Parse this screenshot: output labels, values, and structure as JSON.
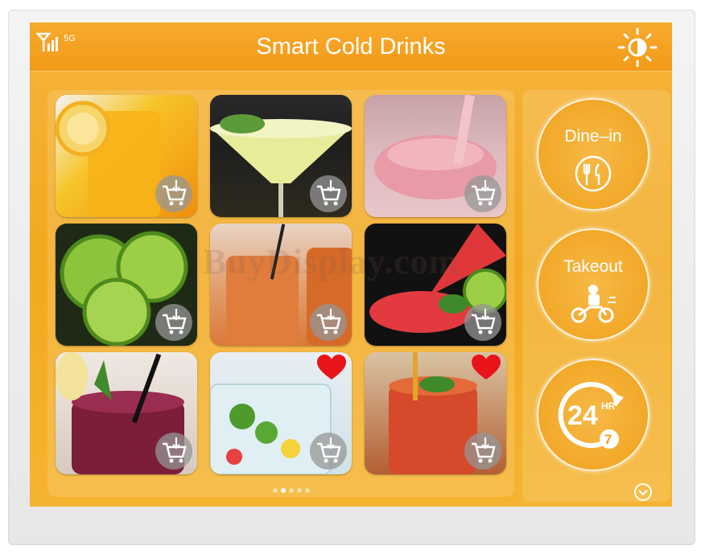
{
  "header": {
    "title": "Smart Cold Drinks",
    "network_label": "5G"
  },
  "drinks": [
    {
      "name": "orange juice",
      "favorite": false
    },
    {
      "name": "lime martini",
      "favorite": false
    },
    {
      "name": "strawberry smoothie",
      "favorite": false
    },
    {
      "name": "limes",
      "favorite": false
    },
    {
      "name": "papaya juice",
      "favorite": false
    },
    {
      "name": "watermelon cocktail",
      "favorite": false
    },
    {
      "name": "berry smoothie",
      "favorite": false
    },
    {
      "name": "mojito",
      "favorite": true
    },
    {
      "name": "red fizz",
      "favorite": true
    }
  ],
  "pager": {
    "pages": 5,
    "active": 2
  },
  "side": {
    "dine_in_label": "Dine–in",
    "takeout_label": "Takeout",
    "hours_label": "24",
    "hr_label": "HR",
    "days_label": "7"
  },
  "colors": {
    "accent": "#f39a1a",
    "favorite": "#e8141a"
  },
  "watermark": "BuyDisplay.com"
}
